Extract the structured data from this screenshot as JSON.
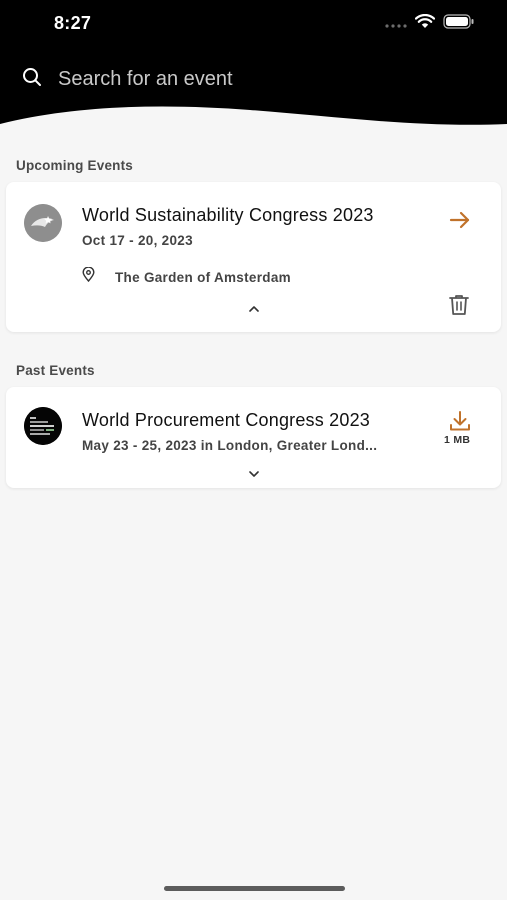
{
  "status_bar": {
    "time": "8:27"
  },
  "search": {
    "placeholder": "Search for an event",
    "value": ""
  },
  "upcoming": {
    "label": "Upcoming Events",
    "events": [
      {
        "title": "World Sustainability Congress 2023",
        "date": "Oct 17 - 20, 2023",
        "location": "The Garden of Amsterdam"
      }
    ]
  },
  "past": {
    "label": "Past Events",
    "events": [
      {
        "title": "World Procurement Congress 2023",
        "date": "May 23 - 25, 2023 in London, Greater Lond...",
        "download_size": "1 MB"
      }
    ]
  },
  "colors": {
    "accent": "#c0722b",
    "header_bg": "#000000",
    "page_bg": "#f6f6f6"
  }
}
